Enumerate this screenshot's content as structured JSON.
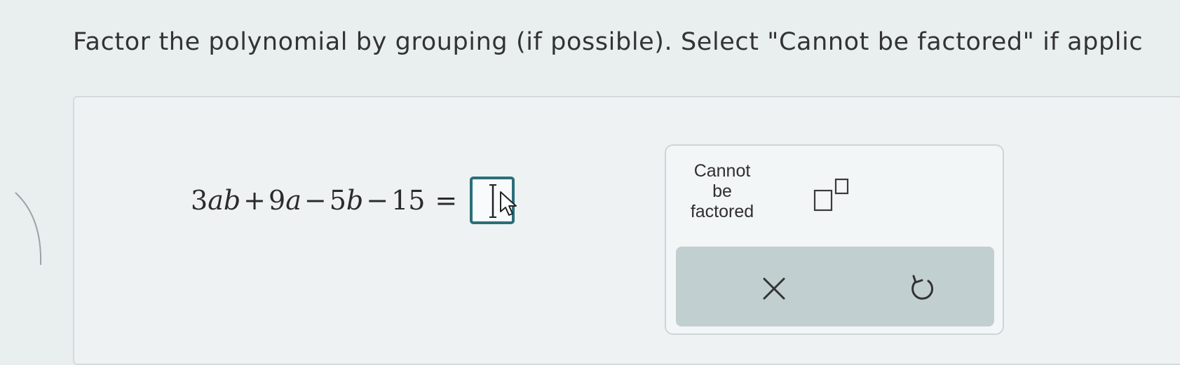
{
  "instruction": "Factor the polynomial by grouping (if possible). Select \"Cannot be factored\" if applic",
  "expression": {
    "t1_coef": "3",
    "t1_var": "ab",
    "plus": "+",
    "t2_coef": "9",
    "t2_var": "a",
    "minus1": "−",
    "t3_coef": "5",
    "t3_var": "b",
    "minus2": "−",
    "t4": "15",
    "equals": "="
  },
  "keypad": {
    "cannot_factor_label": "Cannot\nbe\nfactored",
    "exponent_icon": "superscript-template-icon",
    "clear_icon": "close-icon",
    "undo_icon": "undo-icon"
  },
  "colors": {
    "answer_border": "#2a6f7a",
    "action_bar": "#c2cfd1"
  }
}
